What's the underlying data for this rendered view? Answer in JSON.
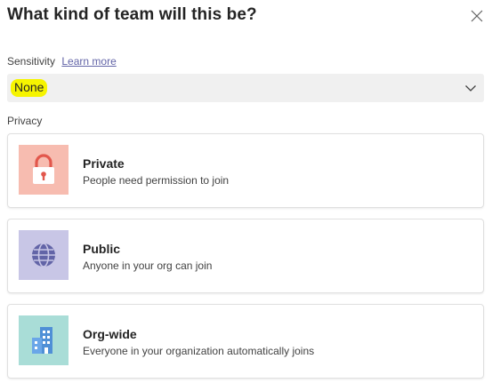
{
  "dialog": {
    "title": "What kind of team will this be?"
  },
  "sensitivity": {
    "label": "Sensitivity",
    "learn_more": "Learn more",
    "selected_value": "None",
    "highlight_color": "#f6f400"
  },
  "privacy": {
    "label": "Privacy",
    "options": [
      {
        "title": "Private",
        "description": "People need permission to join",
        "icon": "lock-icon",
        "tile_color": "#f7bcb0",
        "icon_color": "#e2574c"
      },
      {
        "title": "Public",
        "description": "Anyone in your org can join",
        "icon": "globe-icon",
        "tile_color": "#c8c6e6",
        "icon_color": "#6264a7"
      },
      {
        "title": "Org-wide",
        "description": "Everyone in your organization automatically joins",
        "icon": "building-icon",
        "tile_color": "#a9ddd7",
        "icon_color": "#4f8fd6"
      }
    ]
  }
}
